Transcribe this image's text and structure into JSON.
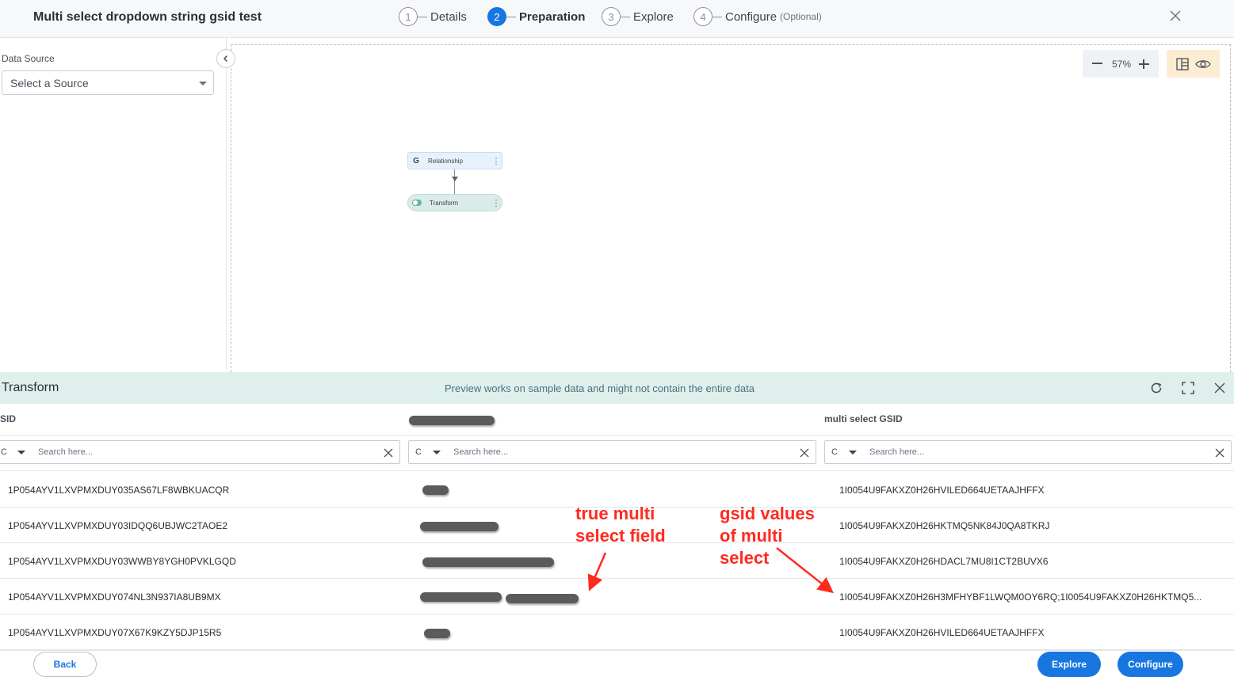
{
  "header": {
    "title": "Multi select dropdown string gsid test",
    "steps": [
      {
        "num": "1",
        "label": "Details",
        "optional": ""
      },
      {
        "num": "2",
        "label": "Preparation",
        "optional": ""
      },
      {
        "num": "3",
        "label": "Explore",
        "optional": ""
      },
      {
        "num": "4",
        "label": "Configure",
        "optional": "(Optional)"
      }
    ],
    "active_step": 2
  },
  "left_panel": {
    "label": "Data Source",
    "select_value": "Select a Source"
  },
  "canvas": {
    "zoom": "57%",
    "nodes": {
      "relationship": {
        "icon_letter": "G",
        "label": "Relationship"
      },
      "transform": {
        "label": "Transform"
      }
    }
  },
  "transform_panel": {
    "title": "Transform",
    "note": "Preview works on sample data and might not contain the entire data",
    "columns": [
      {
        "header": "SID",
        "redacted": false
      },
      {
        "header": "",
        "redacted": true
      },
      {
        "header": "multi select GSID",
        "redacted": false
      }
    ],
    "filter": {
      "type": "C",
      "placeholder": "Search here..."
    },
    "rows": [
      {
        "sid": "1P054AYV1LXVPMXDUY035AS67LF8WBKUACQR",
        "gsid": "1I0054U9FAKXZ0H26HVILED664UETAAJHFFX"
      },
      {
        "sid": "1P054AYV1LXVPMXDUY03IDQQ6UBJWC2TAOE2",
        "gsid": "1I0054U9FAKXZ0H26HKTMQ5NK84J0QA8TKRJ"
      },
      {
        "sid": "1P054AYV1LXVPMXDUY03WWBY8YGH0PVKLGQD",
        "gsid": "1I0054U9FAKXZ0H26HDACL7MU8I1CT2BUVX6"
      },
      {
        "sid": "1P054AYV1LXVPMXDUY074NL3N937IA8UB9MX",
        "gsid": "1I0054U9FAKXZ0H26H3MFHYBF1LWQM0OY6RQ;1I0054U9FAKXZ0H26HKTMQ5..."
      },
      {
        "sid": "1P054AYV1LXVPMXDUY07X67K9KZY5DJP15R5",
        "gsid": "1I0054U9FAKXZ0H26HVILED664UETAAJHFFX"
      }
    ]
  },
  "annotations": {
    "left_lines": [
      "true multi",
      "select field"
    ],
    "right_lines": [
      "gsid values",
      "of multi",
      "select"
    ],
    "color": "#ff2a1f"
  },
  "footer": {
    "back": "Back",
    "explore": "Explore",
    "configure": "Configure"
  },
  "colors": {
    "primary": "#1776e0",
    "transform_header_bg": "#dff0ec",
    "view_toggle_bg": "#fbecd2"
  }
}
